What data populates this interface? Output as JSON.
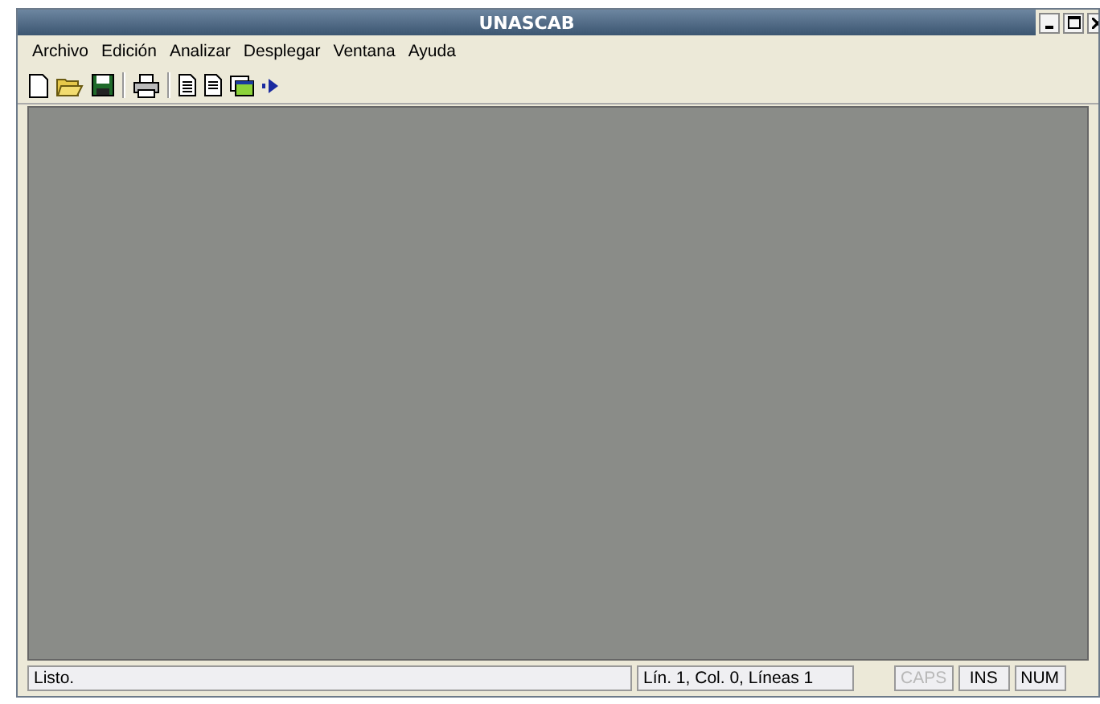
{
  "window": {
    "title": "UNASCAB"
  },
  "menu": [
    {
      "label": "Archivo"
    },
    {
      "label": "Edición"
    },
    {
      "label": "Analizar"
    },
    {
      "label": "Desplegar"
    },
    {
      "label": "Ventana"
    },
    {
      "label": "Ayuda"
    }
  ],
  "status_bar": [
    {
      "text": "Listo.",
      "kind": "message",
      "disabled": false
    },
    {
      "text": "Lín. 1, Col. 0, Líneas 1",
      "kind": "position",
      "disabled": false
    },
    {
      "text": "CAPS",
      "kind": "indicator",
      "disabled": true
    },
    {
      "text": "INS",
      "kind": "indicator",
      "disabled": false
    },
    {
      "text": "NUM",
      "kind": "indicator",
      "disabled": false
    }
  ]
}
